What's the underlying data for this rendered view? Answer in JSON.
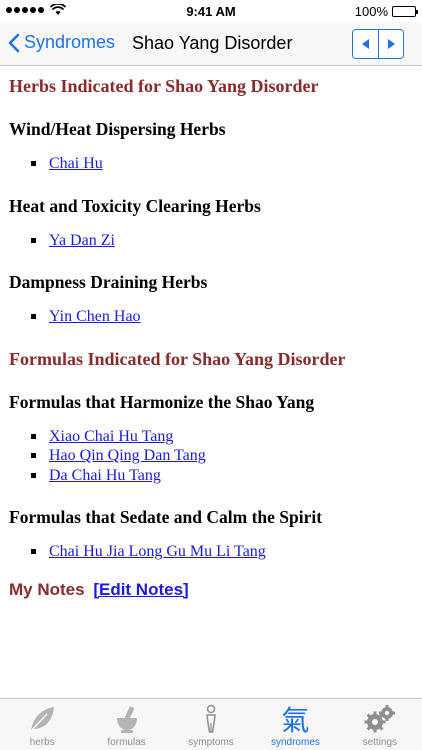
{
  "status_bar": {
    "carrier_dots": 5,
    "time": "9:41 AM",
    "battery": "100%"
  },
  "nav": {
    "back_label": "Syndromes",
    "title": "Shao Yang Disorder"
  },
  "herbs_section": {
    "title": "Herbs Indicated for Shao Yang Disorder",
    "groups": [
      {
        "title": "Wind/Heat Dispersing Herbs",
        "items": [
          "Chai Hu"
        ]
      },
      {
        "title": "Heat and Toxicity Clearing Herbs",
        "items": [
          "Ya Dan Zi"
        ]
      },
      {
        "title": "Dampness Draining Herbs",
        "items": [
          "Yin Chen Hao"
        ]
      }
    ]
  },
  "formulas_section": {
    "title": "Formulas Indicated for Shao Yang Disorder",
    "groups": [
      {
        "title": "Formulas that Harmonize the Shao Yang",
        "items": [
          "Xiao Chai Hu Tang",
          "Hao Qin Qing Dan Tang",
          "Da Chai Hu Tang"
        ]
      },
      {
        "title": "Formulas that Sedate and Calm the Spirit",
        "items": [
          "Chai Hu Jia Long Gu Mu Li Tang"
        ]
      }
    ]
  },
  "notes": {
    "label": "My Notes",
    "edit_label": "[Edit Notes]"
  },
  "tabs": [
    {
      "label": "herbs",
      "icon": "leaf-icon",
      "active": false
    },
    {
      "label": "formulas",
      "icon": "mortar-pestle-icon",
      "active": false
    },
    {
      "label": "symptoms",
      "icon": "person-icon",
      "active": false
    },
    {
      "label": "syndromes",
      "icon": "qi-character-icon",
      "glyph": "氣",
      "active": true
    },
    {
      "label": "settings",
      "icon": "gears-icon",
      "active": false
    }
  ],
  "colors": {
    "accent": "#1a73e8",
    "section_title": "#8b2a2a",
    "link": "#1a1ae0",
    "tab_inactive": "#8e8e93"
  }
}
